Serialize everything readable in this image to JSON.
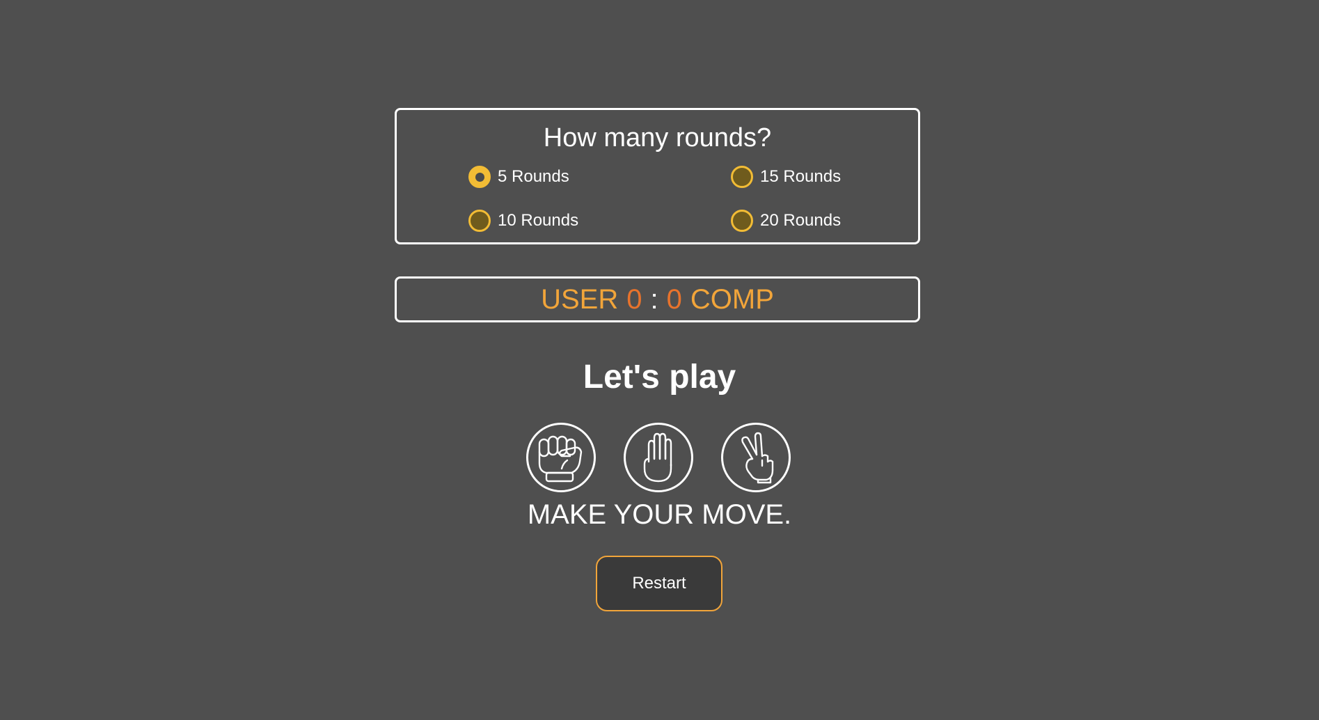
{
  "rounds": {
    "title": "How many rounds?",
    "options": [
      {
        "label": "5 Rounds",
        "checked": true
      },
      {
        "label": "15 Rounds",
        "checked": false
      },
      {
        "label": "10 Rounds",
        "checked": false
      },
      {
        "label": "20 Rounds",
        "checked": false
      }
    ]
  },
  "score": {
    "user_label": "USER",
    "user_score": "0",
    "separator": ":",
    "comp_score": "0",
    "comp_label": "COMP"
  },
  "heading": "Let's play",
  "moves": [
    {
      "name": "rock",
      "icon": "fist-icon"
    },
    {
      "name": "paper",
      "icon": "open-hand-icon"
    },
    {
      "name": "scissors",
      "icon": "peace-hand-icon"
    }
  ],
  "prompt": "MAKE YOUR MOVE.",
  "restart_label": "Restart",
  "colors": {
    "background": "#4f4f4f",
    "accent_yellow": "#f2bc35",
    "score_label": "#f2a53a",
    "score_number": "#e8732c"
  }
}
